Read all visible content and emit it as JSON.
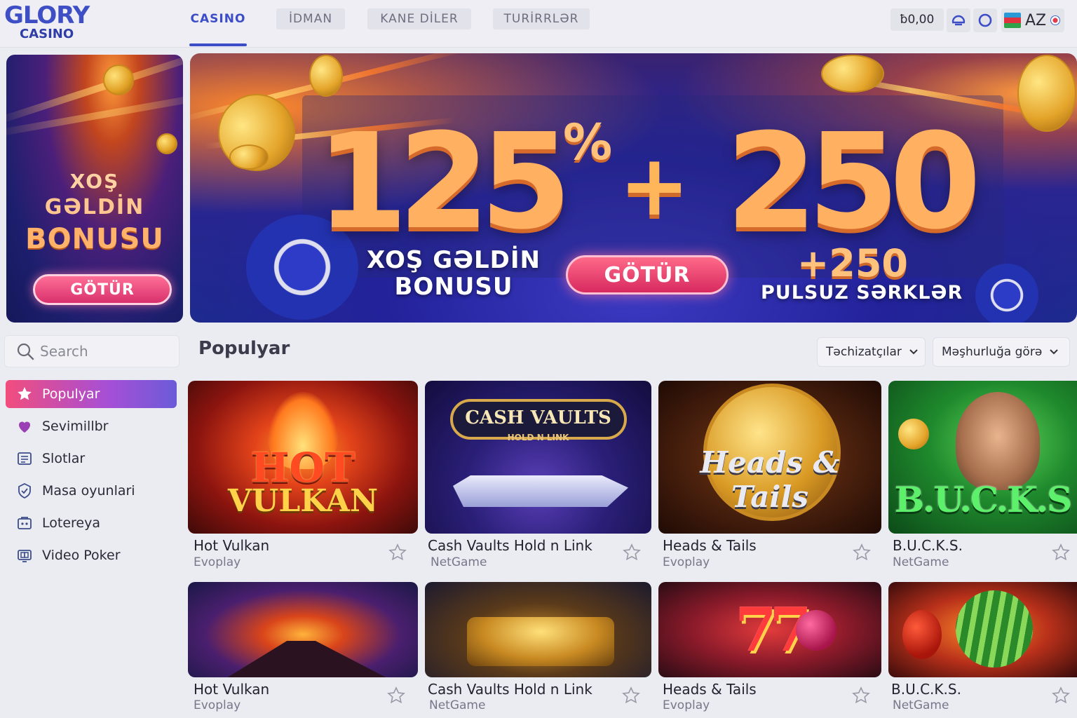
{
  "header": {
    "logo_top": "GLORY",
    "logo_bottom": "CASINO",
    "tabs": [
      {
        "label": "CASINO",
        "active": true
      },
      {
        "label": "İDMAN",
        "active": false
      },
      {
        "label": "KANE DİLER",
        "active": false
      },
      {
        "label": "TURİRRLƏR",
        "active": false
      }
    ],
    "balance": "ƀ0,00",
    "icons": [
      "user-icon",
      "circle-icon"
    ],
    "language": "AZ"
  },
  "side_promo": {
    "line1": "XOŞ",
    "line2": "GƏLDİN",
    "line3": "BONUSU",
    "button": "GÖTÜR"
  },
  "hero": {
    "big_left": "125",
    "percent": "%",
    "plus": "+",
    "big_right": "250",
    "welcome_line1": "XOŞ GƏLDİN",
    "welcome_line2": "BONUSU",
    "button": "GÖTÜR",
    "freespins_num": "+250",
    "freespins_label": "PULSUZ SƏRKLƏR"
  },
  "search": {
    "placeholder": "Search"
  },
  "sidebar": {
    "items": [
      {
        "label": "Populyar",
        "icon": "star-icon",
        "active": true
      },
      {
        "label": "Sevimillbr",
        "icon": "heart-icon",
        "active": false
      },
      {
        "label": "Slotlar",
        "icon": "slot-icon",
        "active": false
      },
      {
        "label": "Masa oyunlari",
        "icon": "table-games-icon",
        "active": false
      },
      {
        "label": "Lotereya",
        "icon": "lottery-icon",
        "active": false
      },
      {
        "label": "Video Poker",
        "icon": "video-poker-icon",
        "active": false
      }
    ]
  },
  "section": {
    "title": "Populyar",
    "filter_providers": "Təchizatçılar",
    "filter_sort": "Məşhurluğa görə"
  },
  "games_row1": [
    {
      "name": "Hot Vulkan",
      "provider": "Evoplay",
      "art": "HOT VULKAN"
    },
    {
      "name": "Cash Vaults Hold n Link",
      "provider": "NetGame",
      "art": "CASH VAULTS"
    },
    {
      "name": "Heads & Tails",
      "provider": "Evoplay",
      "art": "Heads & Tails"
    },
    {
      "name": "B.U.C.K.S.",
      "provider": "NetGame",
      "art": "B.U.C.K.S"
    }
  ],
  "games_row2": [
    {
      "name": "Hot Vulkan",
      "provider": "Evoplay"
    },
    {
      "name": "Cash Vaults Hold n Link",
      "provider": "NetGame"
    },
    {
      "name": "Heads & Tails",
      "provider": "Evoplay"
    },
    {
      "name": "B.U.C.K.S.",
      "provider": "NetGame"
    }
  ],
  "card_art": {
    "cash_vaults_sub": "HOLD N LINK"
  },
  "colors": {
    "accent_blue": "#3c4dc7",
    "active_gradient_start": "#f24d7d",
    "active_gradient_end": "#6b5bd8",
    "button_pink": "#d7295f"
  }
}
